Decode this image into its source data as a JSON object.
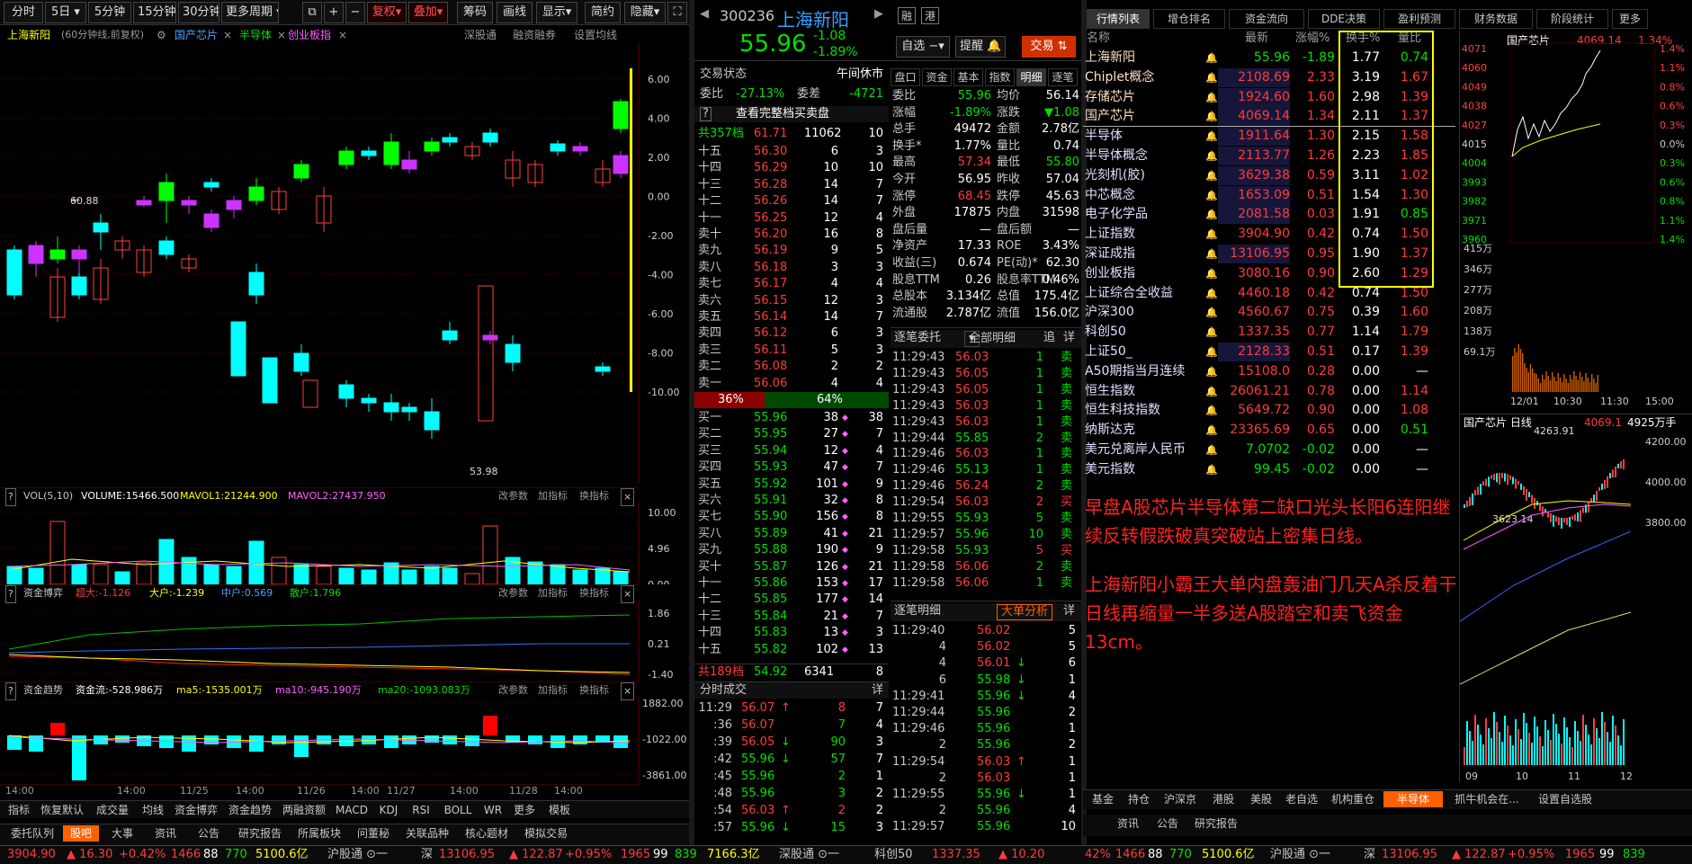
{
  "toolbar": {
    "periods": [
      "分时",
      "5日",
      "5分钟",
      "15分钟",
      "30分钟",
      "更多周期"
    ],
    "fq": "复权",
    "overlay": "叠加",
    "chip": "筹码",
    "draw": "画线",
    "show": "显示",
    "simple": "简约",
    "hide": "隐藏"
  },
  "chart_header": {
    "name": "上海新阳",
    "desc": "(60分钟线,前复权)",
    "tags": [
      "国产芯片",
      "半导体",
      "创业板指"
    ],
    "links": [
      "深股通",
      "融资融券",
      "设置均线"
    ]
  },
  "kline": {
    "hi_label": "60.88",
    "lo_label": "53.98",
    "yticks": [
      "6.00",
      "4.00",
      "2.00",
      "0.00",
      "-2.00",
      "-4.00",
      "-6.00",
      "-8.00",
      "-10.00"
    ]
  },
  "vol": {
    "title": "VOL(5,10)",
    "vol": "VOLUME:15466.500",
    "ma1": "MAVOL1:21244.900",
    "ma2": "MAVOL2:27437.950",
    "btns": [
      "改参数",
      "加指标",
      "换指标"
    ],
    "yticks": [
      "10.00",
      "4.96",
      "0.00"
    ]
  },
  "fund_game": {
    "title": "资金博弈",
    "items": [
      "超大:-1.126",
      "大户:-1.239",
      "中户:0.569",
      "散户:1.796"
    ],
    "yticks": [
      "1.86",
      "0.21",
      "-1.40"
    ]
  },
  "fund_trend": {
    "title": "资金趋势",
    "items": [
      "资金流:-528.986万",
      "ma5:-1535.001万",
      "ma10:-945.190万",
      "ma20:-1093.083万"
    ],
    "yticks": [
      "1882.00",
      "-1022.00",
      "-3861.00"
    ]
  },
  "xaxis": [
    "14:00",
    "14:00",
    "11/25",
    "14:00",
    "11/26",
    "14:00",
    "11/27",
    "14:00",
    "11/28",
    "14:00"
  ],
  "indicator_tabs": [
    "指标",
    "恢复默认",
    "成交量",
    "均线",
    "资金博弈",
    "资金趋势",
    "两融资额",
    "MACD",
    "KDJ",
    "RSI",
    "BOLL",
    "WR",
    "更多",
    "模板"
  ],
  "bottom_tabs": [
    "委托队列",
    "股吧",
    "大事",
    "资讯",
    "公告",
    "研究报告",
    "所属板块",
    "问董秘",
    "关联品种",
    "核心题材",
    "模拟交易"
  ],
  "stock": {
    "code": "300236",
    "name": "上海新阳",
    "price": "55.96",
    "chg": "-1.08",
    "pct": "-1.89%",
    "zixuan": "自选",
    "tixing": "提醒",
    "jiaoyi": "交易"
  },
  "book": {
    "state": "交易状态",
    "state_val": "午间休市",
    "wb": "委比",
    "wb_val": "-27.13%",
    "wc": "委差",
    "wc_val": "-4721",
    "full": "查看完整档买卖盘",
    "sell_total": {
      "lab": "共357档",
      "p": "61.71",
      "v": "11062",
      "n": "10"
    },
    "sells": [
      [
        "十五",
        "56.30",
        "6",
        "3"
      ],
      [
        "十四",
        "56.29",
        "10",
        "10"
      ],
      [
        "十三",
        "56.28",
        "14",
        "7"
      ],
      [
        "十二",
        "56.26",
        "14",
        "7"
      ],
      [
        "十一",
        "56.25",
        "12",
        "4"
      ],
      [
        "卖十",
        "56.20",
        "16",
        "8"
      ],
      [
        "卖九",
        "56.19",
        "9",
        "5"
      ],
      [
        "卖八",
        "56.18",
        "3",
        "3"
      ],
      [
        "卖七",
        "56.17",
        "4",
        "4"
      ],
      [
        "卖六",
        "56.15",
        "12",
        "3"
      ],
      [
        "卖五",
        "56.14",
        "14",
        "7"
      ],
      [
        "卖四",
        "56.12",
        "6",
        "3"
      ],
      [
        "卖三",
        "56.11",
        "5",
        "3"
      ],
      [
        "卖二",
        "56.08",
        "2",
        "2"
      ],
      [
        "卖一",
        "56.06",
        "4",
        "4"
      ]
    ],
    "ratio": [
      "36%",
      "64%"
    ],
    "buys": [
      [
        "买一",
        "55.96",
        "38",
        "38"
      ],
      [
        "买二",
        "55.95",
        "27",
        "7"
      ],
      [
        "买三",
        "55.94",
        "12",
        "4"
      ],
      [
        "买四",
        "55.93",
        "47",
        "7"
      ],
      [
        "买五",
        "55.92",
        "101",
        "9"
      ],
      [
        "买六",
        "55.91",
        "32",
        "8"
      ],
      [
        "买七",
        "55.90",
        "156",
        "8"
      ],
      [
        "买八",
        "55.89",
        "41",
        "21"
      ],
      [
        "买九",
        "55.88",
        "190",
        "9"
      ],
      [
        "买十",
        "55.87",
        "126",
        "21"
      ],
      [
        "十一",
        "55.86",
        "153",
        "17"
      ],
      [
        "十二",
        "55.85",
        "177",
        "14"
      ],
      [
        "十三",
        "55.84",
        "21",
        "7"
      ],
      [
        "十四",
        "55.83",
        "13",
        "3"
      ],
      [
        "十五",
        "55.82",
        "102",
        "13"
      ]
    ],
    "buy_total": {
      "lab": "共189档",
      "p": "54.92",
      "v": "6341",
      "n": "8"
    }
  },
  "mini_tabs": [
    "盘口",
    "资金",
    "基本",
    "指数",
    "明细",
    "逐笔"
  ],
  "quote": [
    [
      "委比",
      "55.96",
      "均价",
      "56.14"
    ],
    [
      "涨幅",
      "-1.89%",
      "涨跌",
      "▼1.08"
    ],
    [
      "总手",
      "49472",
      "金额",
      "2.78亿"
    ],
    [
      "换手*",
      "1.77%",
      "量比",
      "0.74"
    ],
    [
      "最高",
      "57.34",
      "最低",
      "55.80"
    ],
    [
      "今开",
      "56.95",
      "昨收",
      "57.04"
    ],
    [
      "涨停",
      "68.45",
      "跌停",
      "45.63"
    ],
    [
      "外盘",
      "17875",
      "内盘",
      "31598"
    ],
    [
      "盘后量",
      "—",
      "盘后额",
      "—"
    ],
    [
      "净资产",
      "17.33",
      "ROE",
      "3.43%"
    ],
    [
      "收益(三)",
      "0.674",
      "PE(动)*",
      "62.30"
    ],
    [
      "股息TTM",
      "0.26",
      "股息率TTM",
      "0.46%"
    ],
    [
      "总股本",
      "3.134亿",
      "总值",
      "175.4亿"
    ],
    [
      "流通股",
      "2.787亿",
      "流值",
      "156.0亿"
    ]
  ],
  "quote_labels_fix": [
    "最新"
  ],
  "zhubi_entrust": {
    "title": "逐笔委托",
    "filter": "全部明细",
    "btn1": "追",
    "btn2": "详",
    "rows": [
      [
        "11:29:43",
        "56.03",
        "1",
        "卖"
      ],
      [
        "11:29:43",
        "56.05",
        "1",
        "卖"
      ],
      [
        "11:29:43",
        "56.05",
        "1",
        "卖"
      ],
      [
        "11:29:43",
        "56.03",
        "1",
        "卖"
      ],
      [
        "11:29:43",
        "56.03",
        "1",
        "卖"
      ],
      [
        "11:29:44",
        "55.85",
        "2",
        "卖"
      ],
      [
        "11:29:46",
        "56.03",
        "1",
        "卖"
      ],
      [
        "11:29:46",
        "55.13",
        "1",
        "卖"
      ],
      [
        "11:29:46",
        "56.24",
        "2",
        "卖"
      ],
      [
        "11:29:54",
        "56.03",
        "2",
        "买"
      ],
      [
        "11:29:55",
        "55.93",
        "5",
        "卖"
      ],
      [
        "11:29:57",
        "55.96",
        "10",
        "卖"
      ],
      [
        "11:29:58",
        "55.93",
        "5",
        "买"
      ],
      [
        "11:29:58",
        "56.06",
        "2",
        "卖"
      ],
      [
        "11:29:58",
        "56.06",
        "1",
        "卖"
      ]
    ]
  },
  "fenshi": {
    "title": "分时成交",
    "btn": "详",
    "rows": [
      [
        "11:29",
        "56.07",
        "↑",
        "8",
        "7"
      ],
      [
        ":36",
        "56.07",
        "",
        "7",
        "4"
      ],
      [
        ":39",
        "56.05",
        "↓",
        "90",
        "3"
      ],
      [
        ":42",
        "55.96",
        "↓",
        "57",
        "7"
      ],
      [
        ":45",
        "55.96",
        "",
        "2",
        "1"
      ],
      [
        ":48",
        "55.96",
        "",
        "3",
        "2"
      ],
      [
        ":54",
        "56.03",
        "↑",
        "2",
        "2"
      ],
      [
        ":57",
        "55.96",
        "↓",
        "15",
        "3"
      ]
    ]
  },
  "zhubi_detail": {
    "title": "逐笔明细",
    "btn": "大单分析",
    "btn2": "详",
    "rows": [
      [
        "11:29:40",
        "56.02",
        "",
        "5"
      ],
      [
        "4",
        "56.02",
        "",
        "5"
      ],
      [
        "4",
        "56.01",
        "↓",
        "6"
      ],
      [
        "6",
        "55.98",
        "↓",
        "1"
      ],
      [
        "11:29:41",
        "55.96",
        "↓",
        "4"
      ],
      [
        "11:29:44",
        "55.96",
        "",
        "2"
      ],
      [
        "11:29:46",
        "55.96",
        "",
        "1"
      ],
      [
        "2",
        "55.96",
        "",
        "2"
      ],
      [
        "11:29:54",
        "56.03",
        "↑",
        "1"
      ],
      [
        "2",
        "56.03",
        "",
        "1"
      ],
      [
        "11:29:55",
        "55.96",
        "↓",
        "1"
      ],
      [
        "2",
        "55.96",
        "",
        "4"
      ],
      [
        "11:29:57",
        "55.96",
        "",
        "10"
      ]
    ]
  },
  "wl_tabs": [
    "行情列表",
    "增仓排名",
    "资金流向",
    "DDE决策",
    "盈利预测",
    "财务数据",
    "阶段统计",
    "更多"
  ],
  "wl_head": [
    "名称",
    "最新",
    "涨幅%",
    "换手%",
    "量比"
  ],
  "watchlist": [
    [
      "上海新阳",
      "55.96",
      "-1.89",
      "1.77",
      "0.74"
    ],
    [
      "Chiplet概念",
      "2108.69",
      "2.33",
      "3.19",
      "1.67"
    ],
    [
      "存储芯片",
      "1924.60",
      "1.60",
      "2.98",
      "1.39"
    ],
    [
      "国产芯片",
      "4069.14",
      "1.34",
      "2.11",
      "1.37"
    ],
    [
      "半导体",
      "1911.64",
      "1.30",
      "2.15",
      "1.58"
    ],
    [
      "半导体概念",
      "2113.77",
      "1.26",
      "2.23",
      "1.85"
    ],
    [
      "光刻机(胶)",
      "3629.38",
      "0.59",
      "3.11",
      "1.02"
    ],
    [
      "中芯概念",
      "1653.09",
      "0.51",
      "1.54",
      "1.30"
    ],
    [
      "电子化学品",
      "2081.58",
      "0.03",
      "1.91",
      "0.85"
    ],
    [
      "上证指数",
      "3904.90",
      "0.42",
      "0.74",
      "1.50"
    ],
    [
      "深证成指",
      "13106.95",
      "0.95",
      "1.90",
      "1.37"
    ],
    [
      "创业板指",
      "3080.16",
      "0.90",
      "2.60",
      "1.29"
    ],
    [
      "上证综合全收益",
      "4460.18",
      "0.42",
      "0.74",
      "1.50"
    ],
    [
      "沪深300",
      "4560.67",
      "0.75",
      "0.39",
      "1.60"
    ],
    [
      "科创50",
      "1337.35",
      "0.77",
      "1.14",
      "1.79"
    ],
    [
      "上证50_",
      "2128.33",
      "0.51",
      "0.17",
      "1.39"
    ],
    [
      "A50期指当月连续",
      "15108.0",
      "0.28",
      "0.00",
      "—"
    ],
    [
      "恒生指数",
      "26061.21",
      "0.78",
      "0.00",
      "1.14"
    ],
    [
      "恒生科技指数",
      "5649.72",
      "0.90",
      "0.00",
      "1.08"
    ],
    [
      "纳斯达克",
      "23365.69",
      "0.65",
      "0.00",
      "0.51"
    ],
    [
      "美元兑离岸人民币",
      "7.0702",
      "-0.02",
      "0.00",
      "—"
    ],
    [
      "美元指数",
      "99.45",
      "-0.02",
      "0.00",
      "—"
    ]
  ],
  "note1": "早盘A股芯片半导体第二缺口光头长阳6连阳继续反转假跌破真突破站上密集日线。",
  "note2": "上海新阳小霸王大单内盘轰油门几天A杀反着干日线再缩量一半多送A股踏空和卖飞资金13cm。",
  "wl_bottom_tabs": [
    "基金",
    "持仓",
    "沪深京",
    "港股",
    "美股",
    "老自选",
    "机构重仓",
    "半导体",
    "抓牛机会在...",
    "设置自选股"
  ],
  "mid_bottom_tabs": [
    "资讯",
    "公告",
    "研究报告"
  ],
  "minichart": {
    "title": "国产芯片",
    "price": "4069.14",
    "pct": "1.34%",
    "yl": [
      "4071",
      "4060",
      "4049",
      "4038",
      "4027",
      "4015",
      "4004",
      "3993",
      "3982",
      "3971",
      "3960"
    ],
    "yr": [
      "1.4%",
      "1.1%",
      "0.8%",
      "0.6%",
      "0.3%",
      "0.0%",
      "0.3%",
      "0.6%",
      "0.8%",
      "1.1%",
      "1.4%"
    ],
    "vol": [
      "415万",
      "346万",
      "277万",
      "208万",
      "138万",
      "69.1万"
    ],
    "x": [
      "12/01",
      "10:30",
      "11:30",
      "15:00"
    ]
  },
  "daychart": {
    "title": "国产芯片 日线",
    "price": "4069.1",
    "vol": "4925万手",
    "hi": "4263.91",
    "lo": "3623.14",
    "y": [
      "4200.00",
      "4000.00",
      "3800.00"
    ],
    "x": [
      "09",
      "10",
      "11",
      "12"
    ]
  },
  "status": {
    "sh": "3904.90",
    "sh_chg": "▲ 16.30",
    "sh_pct": "+0.42%",
    "sh_up": "1466",
    "sh_flat": "88",
    "sh_dn": "770",
    "sh_amt": "5100.6亿",
    "hgt": "沪股通",
    "sz_l": "深",
    "sz": "13106.95",
    "sz_chg": "▲ 122.87",
    "sz_pct": "+0.95%",
    "sz_up": "1965",
    "sz_flat": "99",
    "sz_dn": "839",
    "sz_amt": "7166.3亿",
    "sgt": "深股通",
    "kc_l": "科创50",
    "kc": "1337.35",
    "kc_chg": "▲ 10.20",
    "r_pct": "42%",
    "r_up": "1466",
    "r_flat": "88",
    "r_dn": "770",
    "r_amt": "5100.6亿",
    "r_hgt": "沪股通",
    "r_sz_l": "深",
    "r_sz": "13106.95",
    "r_sz_chg": "▲ 122.87",
    "r_sz_pct": "+0.95%",
    "r_sz_up": "1965",
    "r_sz_flat": "99",
    "r_sz_dn": "839"
  }
}
